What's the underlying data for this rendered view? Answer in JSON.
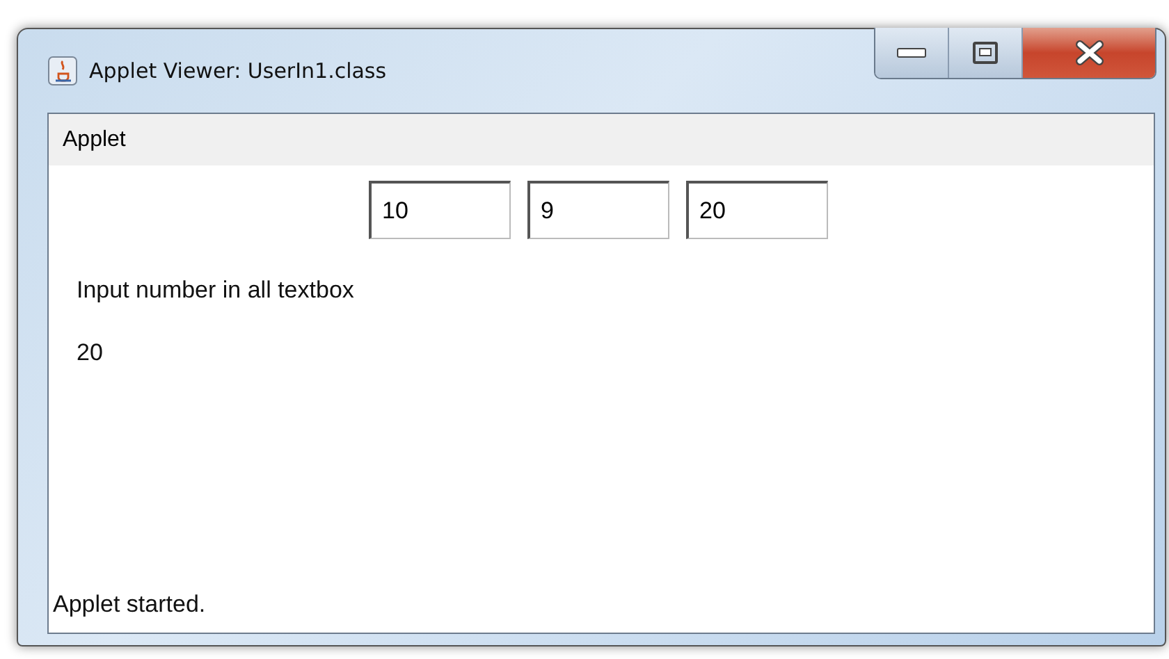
{
  "window": {
    "title": "Applet Viewer: UserIn1.class"
  },
  "menu_bar": [
    "Applet"
  ],
  "fields": [
    {
      "value": "10"
    },
    {
      "value": "9"
    },
    {
      "value": "20"
    }
  ],
  "messages": [
    "Input number in all textbox",
    "20"
  ],
  "status_bar": "Applet started."
}
